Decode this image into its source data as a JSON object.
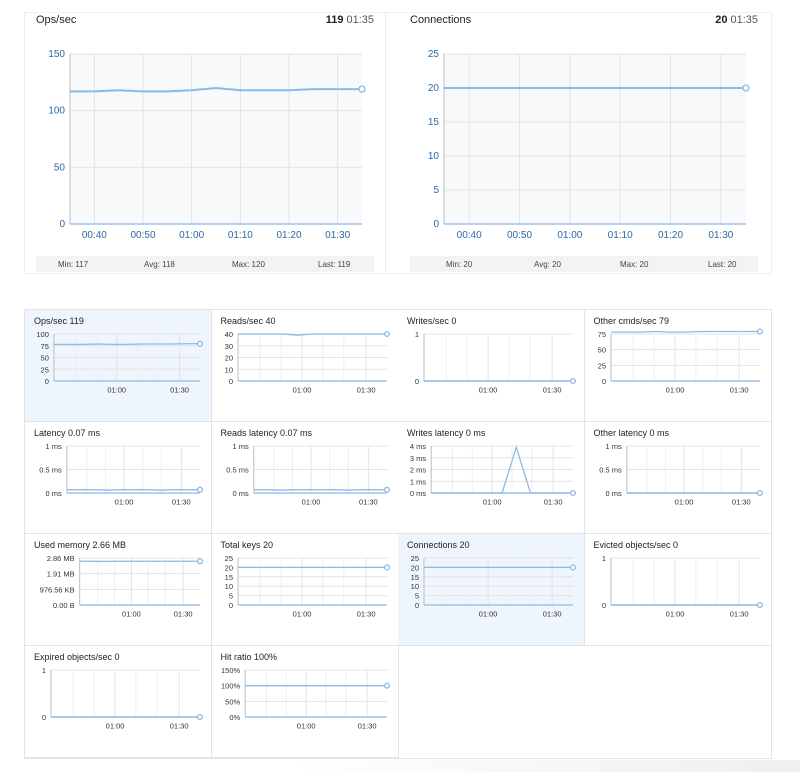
{
  "colors": {
    "line": "#8db9e6",
    "grid": "#e3e3e3",
    "axis_text": "#2b6aa8",
    "bg_plot": "#f7f9fb"
  },
  "chart_data": [
    {
      "type": "line",
      "title": "Ops/sec",
      "stat_value": "119",
      "stat_time": "01:35",
      "x": [
        "00:35",
        "00:40",
        "00:45",
        "00:50",
        "00:55",
        "01:00",
        "01:05",
        "01:10",
        "01:15",
        "01:20",
        "01:25",
        "01:30",
        "01:35"
      ],
      "tick_labels": [
        "00:40",
        "00:50",
        "01:00",
        "01:10",
        "01:20",
        "01:30"
      ],
      "values": [
        117,
        117,
        118,
        117,
        117,
        118,
        120,
        118,
        118,
        118,
        119,
        119,
        119
      ],
      "yticks": [
        "0",
        "50",
        "100",
        "150"
      ],
      "ylim": [
        0,
        150
      ],
      "stats": {
        "min": "Min: 117",
        "avg": "Avg: 118",
        "max": "Max: 120",
        "last": "Last: 119"
      }
    },
    {
      "type": "line",
      "title": "Connections",
      "stat_value": "20",
      "stat_time": "01:35",
      "x": [
        "00:35",
        "00:40",
        "00:45",
        "00:50",
        "00:55",
        "01:00",
        "01:05",
        "01:10",
        "01:15",
        "01:20",
        "01:25",
        "01:30",
        "01:35"
      ],
      "tick_labels": [
        "00:40",
        "00:50",
        "01:00",
        "01:10",
        "01:20",
        "01:30"
      ],
      "values": [
        20,
        20,
        20,
        20,
        20,
        20,
        20,
        20,
        20,
        20,
        20,
        20,
        20
      ],
      "yticks": [
        "0",
        "5",
        "10",
        "15",
        "20",
        "25"
      ],
      "ylim": [
        0,
        25
      ],
      "stats": {
        "min": "Min: 20",
        "avg": "Avg: 20",
        "max": "Max: 20",
        "last": "Last: 20"
      }
    },
    {
      "type": "line",
      "title": "Ops/sec 119",
      "highlight": true,
      "ylim": [
        0,
        150
      ],
      "yticks": [
        "0",
        "25",
        "50",
        "75",
        "100"
      ],
      "values": [
        117,
        117,
        117,
        118,
        117,
        117,
        118,
        118,
        118,
        119,
        119
      ],
      "tick_labels": [
        "01:00",
        "01:30"
      ]
    },
    {
      "type": "line",
      "title": "Reads/sec 40",
      "highlight": false,
      "ylim": [
        0,
        40
      ],
      "yticks": [
        "0",
        "10",
        "20",
        "30",
        "40"
      ],
      "values": [
        40,
        40,
        40,
        40,
        39,
        40,
        40,
        40,
        40,
        40,
        40
      ],
      "tick_labels": [
        "01:00",
        "01:30"
      ]
    },
    {
      "type": "line",
      "title": "Writes/sec 0",
      "highlight": false,
      "ylim": [
        0,
        1
      ],
      "yticks": [
        "0",
        "1"
      ],
      "values": [
        0,
        0,
        0,
        0,
        0,
        0,
        0,
        0,
        0,
        0,
        0
      ],
      "tick_labels": [
        "01:00",
        "01:30"
      ]
    },
    {
      "type": "line",
      "title": "Other cmds/sec 79",
      "highlight": false,
      "ylim": [
        0,
        75
      ],
      "yticks": [
        "0",
        "25",
        "50",
        "75"
      ],
      "values": [
        78,
        78,
        78,
        79,
        78,
        78,
        79,
        79,
        79,
        79,
        79
      ],
      "tick_labels": [
        "01:00",
        "01:30"
      ]
    },
    {
      "type": "line",
      "title": "Latency 0.07 ms",
      "highlight": false,
      "ylim": [
        0,
        1
      ],
      "yticks": [
        "0 ms",
        "0.5 ms",
        "1 ms"
      ],
      "values": [
        0.07,
        0.07,
        0.07,
        0.06,
        0.07,
        0.07,
        0.07,
        0.06,
        0.07,
        0.07,
        0.07
      ],
      "tick_labels": [
        "01:00",
        "01:30"
      ]
    },
    {
      "type": "line",
      "title": "Reads latency 0.07 ms",
      "highlight": false,
      "ylim": [
        0,
        1
      ],
      "yticks": [
        "0 ms",
        "0.5 ms",
        "1 ms"
      ],
      "values": [
        0.07,
        0.07,
        0.06,
        0.07,
        0.07,
        0.07,
        0.07,
        0.06,
        0.07,
        0.07,
        0.07
      ],
      "tick_labels": [
        "01:00",
        "01:30"
      ]
    },
    {
      "type": "line",
      "title": "Writes latency 0 ms",
      "highlight": false,
      "ylim": [
        0,
        4
      ],
      "yticks": [
        "0 ms",
        "1 ms",
        "2 ms",
        "3 ms",
        "4 ms"
      ],
      "values": [
        0,
        0,
        0,
        0,
        0,
        0,
        3.9,
        0,
        0,
        0,
        0
      ],
      "tick_labels": [
        "01:00",
        "01:30"
      ]
    },
    {
      "type": "line",
      "title": "Other latency 0 ms",
      "highlight": false,
      "ylim": [
        0,
        1
      ],
      "yticks": [
        "0 ms",
        "0.5 ms",
        "1 ms"
      ],
      "values": [
        0,
        0,
        0,
        0,
        0,
        0,
        0,
        0,
        0,
        0,
        0
      ],
      "tick_labels": [
        "01:00",
        "01:30"
      ]
    },
    {
      "type": "line",
      "title": "Used memory 2.66 MB",
      "highlight": false,
      "ylim": [
        0,
        2.86
      ],
      "yticks": [
        "0.00 B",
        "976.56 KB",
        "1.91 MB",
        "2.86 MB"
      ],
      "values": [
        2.66,
        2.66,
        2.65,
        2.66,
        2.66,
        2.66,
        2.66,
        2.66,
        2.66,
        2.66,
        2.66
      ],
      "tick_labels": [
        "01:00",
        "01:30"
      ]
    },
    {
      "type": "line",
      "title": "Total keys 20",
      "highlight": false,
      "ylim": [
        0,
        25
      ],
      "yticks": [
        "0",
        "5",
        "10",
        "15",
        "20",
        "25"
      ],
      "values": [
        20,
        20,
        20,
        20,
        20,
        20,
        20,
        20,
        20,
        20,
        20
      ],
      "tick_labels": [
        "01:00",
        "01:30"
      ]
    },
    {
      "type": "line",
      "title": "Connections 20",
      "highlight": true,
      "ylim": [
        0,
        25
      ],
      "yticks": [
        "0",
        "5",
        "10",
        "15",
        "20",
        "25"
      ],
      "values": [
        20,
        20,
        20,
        20,
        20,
        20,
        20,
        20,
        20,
        20,
        20
      ],
      "tick_labels": [
        "01:00",
        "01:30"
      ]
    },
    {
      "type": "line",
      "title": "Evicted objects/sec 0",
      "highlight": false,
      "ylim": [
        0,
        1
      ],
      "yticks": [
        "0",
        "1"
      ],
      "values": [
        0,
        0,
        0,
        0,
        0,
        0,
        0,
        0,
        0,
        0,
        0
      ],
      "tick_labels": [
        "01:00",
        "01:30"
      ]
    },
    {
      "type": "line",
      "title": "Expired objects/sec 0",
      "highlight": false,
      "ylim": [
        0,
        1
      ],
      "yticks": [
        "0",
        "1"
      ],
      "values": [
        0,
        0,
        0,
        0,
        0,
        0,
        0,
        0,
        0,
        0,
        0
      ],
      "tick_labels": [
        "01:00",
        "01:30"
      ]
    },
    {
      "type": "line",
      "title": "Hit ratio 100%",
      "highlight": false,
      "ylim": [
        0,
        150
      ],
      "yticks": [
        "0%",
        "50%",
        "100%",
        "150%"
      ],
      "values": [
        100,
        100,
        100,
        100,
        100,
        100,
        100,
        100,
        100,
        100,
        100
      ],
      "tick_labels": [
        "01:00",
        "01:30"
      ]
    }
  ]
}
